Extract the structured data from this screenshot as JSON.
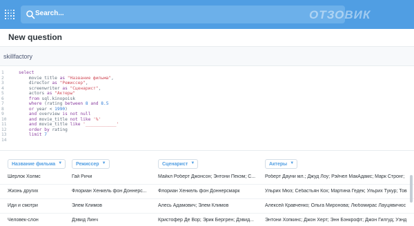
{
  "navbar": {
    "search_placeholder": "Search...",
    "logo": "metabase-logo-icon",
    "color": "#509ee3"
  },
  "question": {
    "title": "New question"
  },
  "database": {
    "name": "skillfactory"
  },
  "editor": {
    "lines": [
      {
        "n": "1",
        "parts": [
          [
            "kw",
            "select"
          ]
        ]
      },
      {
        "n": "2",
        "parts": [
          [
            "plain",
            "    movie_title "
          ],
          [
            "kw",
            "as"
          ],
          [
            "plain",
            " "
          ],
          [
            "str",
            "\"Название фильма\""
          ],
          [
            "plain",
            ","
          ]
        ]
      },
      {
        "n": "3",
        "parts": [
          [
            "plain",
            "    director "
          ],
          [
            "kw",
            "as"
          ],
          [
            "plain",
            " "
          ],
          [
            "str",
            "\"Режиссер\""
          ],
          [
            "plain",
            ","
          ]
        ]
      },
      {
        "n": "4",
        "parts": [
          [
            "plain",
            "    screenwriter "
          ],
          [
            "kw",
            "as"
          ],
          [
            "plain",
            " "
          ],
          [
            "str",
            "\"Сценарист\""
          ],
          [
            "plain",
            ","
          ]
        ]
      },
      {
        "n": "5",
        "parts": [
          [
            "plain",
            "    actors "
          ],
          [
            "kw",
            "as"
          ],
          [
            "plain",
            " "
          ],
          [
            "str",
            "\"Актеры\""
          ]
        ]
      },
      {
        "n": "6",
        "parts": [
          [
            "plain",
            "    "
          ],
          [
            "kw",
            "from"
          ],
          [
            "plain",
            " sql.kinopoisk"
          ]
        ]
      },
      {
        "n": "7",
        "parts": [
          [
            "plain",
            "    "
          ],
          [
            "kw",
            "where"
          ],
          [
            "plain",
            " (rating "
          ],
          [
            "kw",
            "between"
          ],
          [
            "plain",
            " "
          ],
          [
            "num",
            "8"
          ],
          [
            "plain",
            " "
          ],
          [
            "kw",
            "and"
          ],
          [
            "plain",
            " "
          ],
          [
            "num",
            "8.5"
          ]
        ]
      },
      {
        "n": "8",
        "parts": [
          [
            "plain",
            "    "
          ],
          [
            "kw",
            "or"
          ],
          [
            "plain",
            " year < "
          ],
          [
            "num",
            "1990"
          ],
          [
            "plain",
            ")"
          ]
        ]
      },
      {
        "n": "9",
        "parts": [
          [
            "plain",
            "    "
          ],
          [
            "kw",
            "and"
          ],
          [
            "plain",
            " overview "
          ],
          [
            "kw",
            "is not null"
          ]
        ]
      },
      {
        "n": "10",
        "parts": [
          [
            "plain",
            "    "
          ],
          [
            "kw",
            "and"
          ],
          [
            "plain",
            " movie_title "
          ],
          [
            "kw",
            "not like"
          ],
          [
            "plain",
            " "
          ],
          [
            "str",
            "'%'"
          ]
        ]
      },
      {
        "n": "11",
        "parts": [
          [
            "plain",
            "    "
          ],
          [
            "kw",
            "and"
          ],
          [
            "plain",
            " movie_title "
          ],
          [
            "kw",
            "like"
          ],
          [
            "plain",
            " "
          ],
          [
            "str",
            "'____________'"
          ]
        ]
      },
      {
        "n": "12",
        "parts": [
          [
            "plain",
            "    "
          ],
          [
            "kw",
            "order by"
          ],
          [
            "plain",
            " rating"
          ]
        ]
      },
      {
        "n": "13",
        "parts": [
          [
            "plain",
            "    "
          ],
          [
            "kw",
            "limit"
          ],
          [
            "plain",
            " "
          ],
          [
            "num",
            "7"
          ]
        ]
      },
      {
        "n": "14",
        "parts": [
          [
            "plain",
            ""
          ]
        ]
      }
    ]
  },
  "results": {
    "columns": [
      "Название фильма",
      "Режиссер",
      "Сценарист",
      "Актеры"
    ],
    "rows": [
      [
        "Шерлок Холмс",
        "Гай Ричи",
        "Майкл Роберт Джонсон; Энтони Пекэм; С...",
        "Роберт Дауни мл.; Джуд Лоу; Рэйчел МакАдамс; Марк Стронг;"
      ],
      [
        "Жизнь других",
        "Флориан Хенкель фон Доннерс...",
        "Флориан Хенкель фон Доннерсмарк",
        "Ульрих Мюэ; Себастьян Кох; Мартина Гедек; Ульрих Тукур; Тов"
      ],
      [
        "Иди и смотри",
        "Элем Климов",
        "Алесь Адамович; Элем Климов",
        "Алексей Кравченко; Ольга Миронова; Любомирас Лауцявичюс"
      ],
      [
        "Человек-слон",
        "Дэвид Линч",
        "Кристофер Де Вор; Эрик Бергрен; Дэвид...",
        "Энтони Хопкинс; Джон Херт; Энн Бэнкрофт; Джон Гилгуд; Уэнд"
      ]
    ]
  },
  "watermark": {
    "text": "ОТЗОВИК"
  }
}
